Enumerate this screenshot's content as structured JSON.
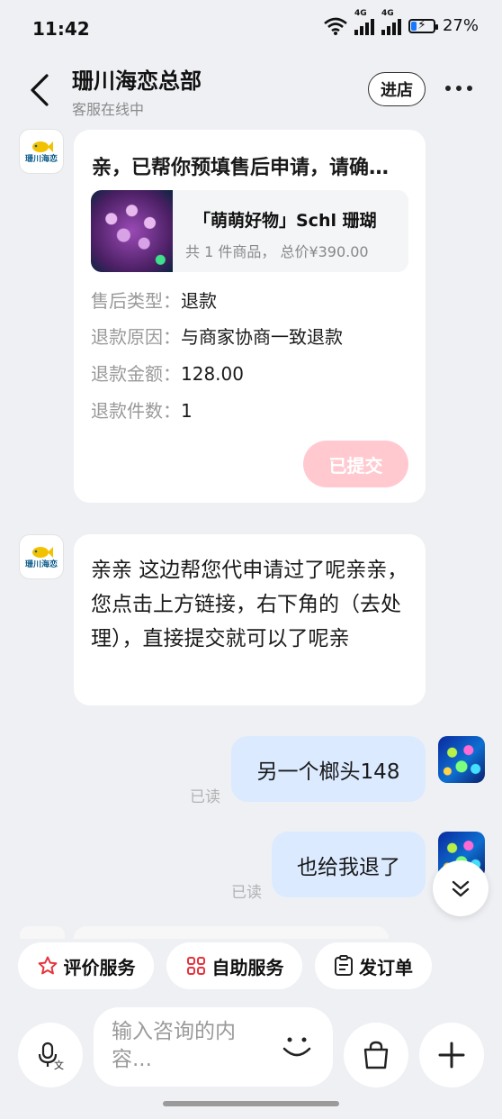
{
  "status_bar": {
    "time": "11:42",
    "network_1": "4G",
    "network_2": "4G",
    "battery": "27%",
    "battery_level": 0.27
  },
  "header": {
    "shop_name": "珊川海恋总部",
    "subtitle": "客服在线中",
    "enter_shop": "进店"
  },
  "shop_logo": {
    "text": "珊川海恋"
  },
  "card": {
    "title": "亲，已帮你预填售后申请，请确认后提交",
    "product_name": "「萌萌好物」Schl 珊瑚",
    "product_summary": "共 1 件商品， 总价¥390.00",
    "rows": [
      {
        "key": "售后类型：",
        "value": "退款"
      },
      {
        "key": "退款原因：",
        "value": "与商家协商一致退款"
      },
      {
        "key": "退款金额：",
        "value": "128.00"
      },
      {
        "key": "退款件数：",
        "value": "1"
      }
    ],
    "submit_status": "已提交"
  },
  "messages": {
    "shop_reply": "亲亲 这边帮您代申请过了呢亲亲，您点击上方链接，右下角的（去处理），直接提交就可以了呢亲",
    "user_1": "另一个榔头148",
    "user_1_status": "已读",
    "user_2": "也给我退了",
    "user_2_status": "已读"
  },
  "quick_actions": [
    {
      "label": "评价服务",
      "icon": "star-icon"
    },
    {
      "label": "自助服务",
      "icon": "grid-icon"
    },
    {
      "label": "发订单",
      "icon": "clipboard-icon"
    }
  ],
  "input": {
    "placeholder": "输入咨询的内容..."
  },
  "colors": {
    "accent_pink": "#ffc9cf",
    "user_bubble": "#dbeaff",
    "star_red": "#e8323c"
  }
}
